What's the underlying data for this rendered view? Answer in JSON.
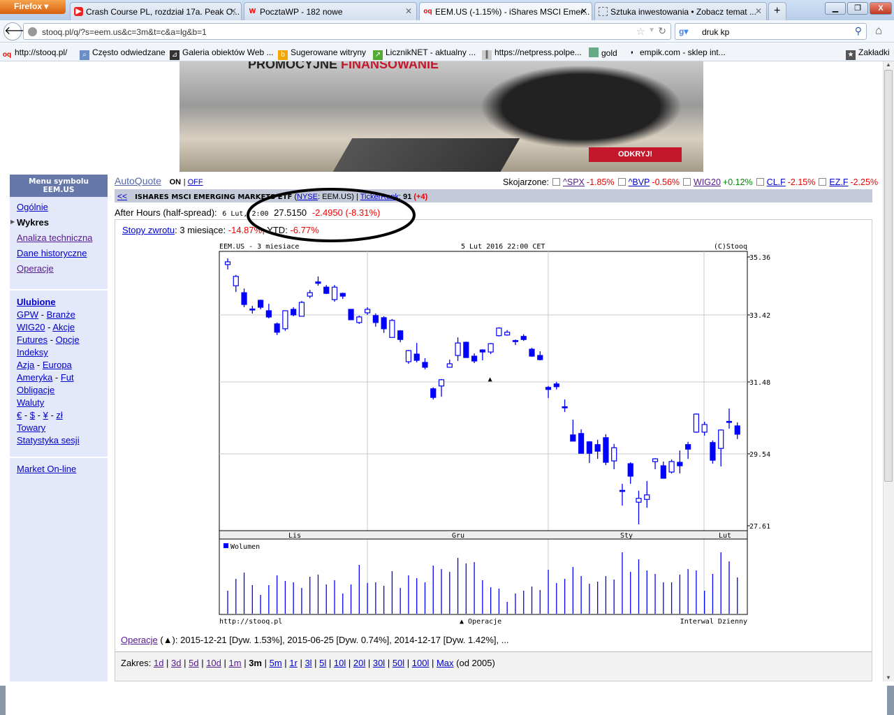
{
  "browser": {
    "menu_button": "Firefox",
    "tabs": [
      {
        "label": "Crash Course PL, rozdział 17a. Peak O...",
        "icon": "youtube-icon"
      },
      {
        "label": "PocztaWP - 182 nowe",
        "icon": "wp-icon"
      },
      {
        "label": "EEM.US (-1.15%) - iShares MSCI Emer...",
        "icon": "stooq-icon",
        "active": true
      },
      {
        "label": "Sztuka inwestowania • Zobacz temat ...",
        "icon": "page-icon"
      }
    ],
    "url": "stooq.pl/q/?s=eem.us&c=3m&t=c&a=lg&b=1",
    "search_value": "druk kp",
    "bookmarks": [
      "http://stooq.pl/",
      "Często odwiedzane",
      "Galeria obiektów Web ...",
      "Sugerowane witryny",
      "LicznikNET - aktualny ...",
      "https://netpress.polpe...",
      "gold",
      "empik.com - sklep int..."
    ],
    "bookmarks_menu": "Zakładki"
  },
  "banner": {
    "headline_a": "PROMOCYJNE ",
    "headline_b": "FINANSOWANIE",
    "cta": "ODKRYJ!",
    "brand_color": "#c4172c"
  },
  "sidebar": {
    "title_line1": "Menu symbolu",
    "title_line2": "EEM.US",
    "items": [
      "Ogólnie",
      "Wykres",
      "Analiza techniczna",
      "Dane historyczne",
      "Operacje"
    ],
    "active_item": "Wykres",
    "favorites_title": "Ulubione",
    "favorites": [
      [
        "GPW",
        "Branże"
      ],
      [
        "WIG20",
        "Akcje"
      ],
      [
        "Futures",
        "Opcje"
      ],
      [
        "Indeksy"
      ],
      [
        "Azja",
        "Europa"
      ],
      [
        "Ameryka",
        "Fut"
      ],
      [
        "Obligacje"
      ],
      [
        "Waluty"
      ],
      [
        "€",
        "$",
        "¥",
        "zł"
      ],
      [
        "Towary"
      ],
      [
        "Statystyka sesji"
      ]
    ],
    "market_online": "Market On-line"
  },
  "quote": {
    "autoquote": "AutoQuote",
    "on": "ON",
    "off": "OFF",
    "related_label": "Skojarzone:",
    "related": [
      {
        "sym": "^SPX",
        "chg": "-1.85%"
      },
      {
        "sym": "^BVP",
        "chg": "-0.56%"
      },
      {
        "sym": "WIG20",
        "chg": "+0.12%"
      },
      {
        "sym": "CL.F",
        "chg": "-2.15%"
      },
      {
        "sym": "EZ.F",
        "chg": "-2.25%"
      }
    ],
    "back": "<<",
    "name": "ISHARES MSCI EMERGING MARKETS ETF",
    "exchange": "NYSE",
    "symbol": "EEM.US",
    "tickerrank_label": "TickerRank",
    "tickerrank": "91",
    "tickerrank_change": "(+4)",
    "after_hours_label": "After Hours (half-spread):",
    "after_hours_time": "6 Lut, 2:00",
    "after_hours_price": "27.5150",
    "after_hours_change": "-2.4950 (-8.31%)",
    "returns_link": "Stopy zwrotu",
    "returns_3m_label": ": 3 miesiące:",
    "returns_3m": "-14.87%",
    "returns_ytd_label": "YTD:",
    "returns_ytd": "-6.77%"
  },
  "chart_data": {
    "type": "candlestick",
    "title": "EEM.US - 3 miesiace",
    "timestamp": "5 Lut 2016 22:00 CET",
    "copyright": "(C)Stooq",
    "y_ticks": [
      35.36,
      33.42,
      31.48,
      29.54,
      27.61
    ],
    "month_labels": [
      "Lis",
      "Gru",
      "Sty",
      "Lut"
    ],
    "ohlc": [
      [
        35.14,
        35.32,
        35.0,
        35.22
      ],
      [
        34.53,
        34.84,
        34.35,
        34.8
      ],
      [
        34.33,
        34.45,
        33.91,
        33.99
      ],
      [
        33.86,
        33.95,
        33.73,
        33.84
      ],
      [
        34.11,
        34.13,
        33.85,
        33.91
      ],
      [
        33.81,
        34.01,
        33.59,
        33.63
      ],
      [
        33.43,
        33.47,
        33.11,
        33.19
      ],
      [
        33.29,
        33.81,
        33.23,
        33.81
      ],
      [
        33.85,
        33.91,
        33.65,
        33.69
      ],
      [
        33.65,
        34.09,
        33.65,
        34.05
      ],
      [
        34.23,
        34.41,
        34.17,
        34.33
      ],
      [
        34.64,
        34.8,
        34.53,
        34.6
      ],
      [
        34.49,
        34.55,
        34.29,
        34.31
      ],
      [
        34.13,
        34.55,
        34.07,
        34.49
      ],
      [
        34.31,
        34.33,
        34.15,
        34.23
      ],
      [
        33.85,
        33.85,
        33.55,
        33.55
      ],
      [
        33.47,
        33.67,
        33.43,
        33.63
      ],
      [
        33.75,
        33.91,
        33.69,
        33.85
      ],
      [
        33.67,
        33.73,
        33.35,
        33.47
      ],
      [
        33.61,
        33.65,
        33.17,
        33.29
      ],
      [
        33.04,
        33.57,
        33.04,
        33.53
      ],
      [
        33.23,
        33.25,
        32.9,
        32.98
      ],
      [
        32.34,
        32.68,
        32.28,
        32.66
      ],
      [
        32.56,
        32.88,
        32.32,
        32.38
      ],
      [
        32.32,
        32.44,
        32.12,
        32.18
      ],
      [
        31.56,
        31.6,
        31.25,
        31.31
      ],
      [
        31.64,
        31.84,
        31.33,
        31.82
      ],
      [
        32.18,
        32.4,
        32.18,
        32.28
      ],
      [
        32.52,
        33.04,
        32.36,
        32.88
      ],
      [
        32.9,
        32.92,
        32.46,
        32.46
      ],
      [
        32.5,
        32.58,
        32.3,
        32.36
      ],
      [
        32.68,
        32.7,
        32.38,
        32.62
      ],
      [
        32.62,
        32.88,
        32.56,
        32.86
      ],
      [
        33.09,
        33.33,
        33.07,
        33.31
      ],
      [
        33.11,
        33.25,
        33.09,
        33.19
      ],
      [
        32.95,
        32.98,
        32.82,
        32.93
      ],
      [
        33.07,
        33.13,
        32.94,
        32.98
      ],
      [
        32.7,
        32.74,
        32.48,
        32.5
      ],
      [
        32.52,
        32.64,
        32.38,
        32.4
      ],
      [
        31.6,
        31.64,
        31.29,
        31.54
      ],
      [
        31.7,
        31.76,
        31.54,
        31.62
      ],
      [
        31.04,
        31.25,
        30.89,
        31.02
      ],
      [
        30.23,
        30.67,
        30.05,
        30.05
      ],
      [
        30.27,
        30.39,
        29.7,
        29.7
      ],
      [
        30.03,
        30.05,
        29.42,
        29.7
      ],
      [
        29.95,
        30.09,
        29.54,
        29.76
      ],
      [
        30.15,
        30.25,
        29.36,
        29.44
      ],
      [
        29.48,
        29.97,
        29.24,
        29.86
      ],
      [
        28.63,
        28.82,
        28.19,
        28.61
      ],
      [
        29.4,
        29.44,
        28.82,
        29.04
      ],
      [
        28.29,
        28.62,
        27.65,
        28.4
      ],
      [
        28.37,
        28.9,
        28.13,
        28.5
      ],
      [
        29.46,
        29.56,
        29.24,
        29.54
      ],
      [
        29.34,
        29.46,
        28.98,
        28.98
      ],
      [
        29.16,
        29.52,
        29.12,
        29.46
      ],
      [
        29.44,
        29.78,
        29.12,
        29.34
      ],
      [
        29.95,
        30.03,
        29.54,
        29.82
      ],
      [
        30.31,
        30.85,
        30.29,
        30.83
      ],
      [
        30.31,
        30.61,
        30.21,
        30.53
      ],
      [
        30.01,
        30.07,
        29.4,
        29.5
      ],
      [
        29.84,
        30.39,
        29.32,
        30.37
      ],
      [
        30.62,
        30.99,
        30.41,
        30.6
      ],
      [
        30.49,
        30.59,
        30.11,
        30.25
      ]
    ],
    "dividend_marker_index": 32,
    "volume_label": "Wolumen",
    "volume_relative": [
      99,
      150,
      177,
      123,
      81,
      123,
      165,
      141,
      135,
      111,
      159,
      168,
      126,
      144,
      87,
      126,
      210,
      132,
      135,
      120,
      183,
      111,
      165,
      153,
      135,
      207,
      192,
      180,
      240,
      216,
      222,
      144,
      114,
      108,
      51,
      87,
      99,
      117,
      102,
      189,
      132,
      150,
      201,
      162,
      129,
      138,
      162,
      147,
      264,
      180,
      234,
      186,
      171,
      135,
      135,
      168,
      192,
      186,
      99,
      171,
      264,
      225,
      156
    ],
    "footer_left": "http://stooq.pl",
    "footer_mid": "▲ Operacje",
    "footer_right": "Interwal Dzienny",
    "colors": {
      "candle": "#0000ff",
      "grid": "#c8c8c8"
    }
  },
  "operations": {
    "link": "Operacje",
    "text": " (▲): 2015-12-21 [Dyw. 1.53%], 2015-06-25 [Dyw. 0.74%], 2014-12-17 [Dyw. 1.42%], ..."
  },
  "range": {
    "label": "Zakres:",
    "options": [
      "1d",
      "3d",
      "5d",
      "10d",
      "1m",
      "3m",
      "5m",
      "1r",
      "3l",
      "5l",
      "10l",
      "20l",
      "30l",
      "50l",
      "100l",
      "Max"
    ],
    "selected": "3m",
    "suffix": "(od 2005)"
  }
}
